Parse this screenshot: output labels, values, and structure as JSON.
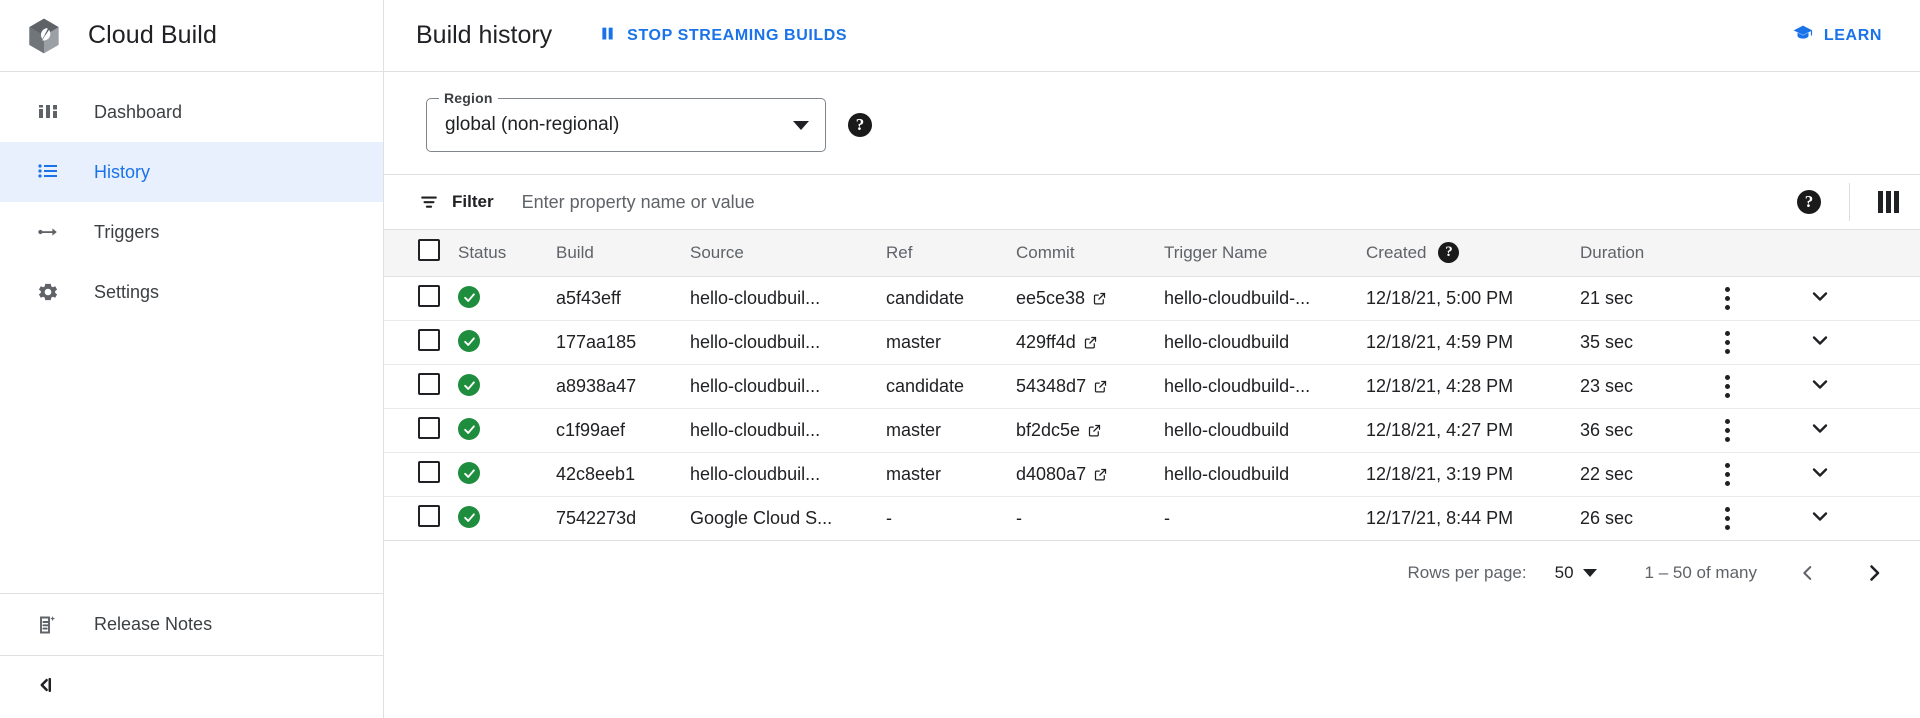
{
  "colors": {
    "accent": "#1a73e8",
    "success": "#1e8e3e",
    "nav_active_bg": "#e8f0fe",
    "header_bg": "#f5f5f5",
    "text_primary": "#202124",
    "text_secondary": "#5f6368"
  },
  "sidebar": {
    "product_title": "Cloud Build",
    "logo_icon": "cloud-build-logo-icon",
    "items": [
      {
        "label": "Dashboard",
        "icon": "dashboard-icon",
        "active": false
      },
      {
        "label": "History",
        "icon": "list-icon",
        "active": true
      },
      {
        "label": "Triggers",
        "icon": "arrow-switch-icon",
        "active": false
      },
      {
        "label": "Settings",
        "icon": "gear-icon",
        "active": false
      }
    ],
    "release_notes": {
      "label": "Release Notes",
      "icon": "release-notes-icon"
    },
    "collapse": {
      "icon": "collapse-panel-icon",
      "label": ""
    }
  },
  "topbar": {
    "page_title": "Build history",
    "stop_streaming_label": "STOP STREAMING BUILDS",
    "stop_streaming_icon": "pause-icon",
    "learn_label": "LEARN",
    "learn_icon": "graduation-cap-icon"
  },
  "region": {
    "legend": "Region",
    "value": "global (non-regional)",
    "dropdown_icon": "chevron-down-icon",
    "help_icon": "help-icon",
    "help_label": "?"
  },
  "filter": {
    "icon": "filter-icon",
    "label": "Filter",
    "placeholder": "Enter property name or value",
    "value": "",
    "help_label": "?",
    "help_icon": "help-icon",
    "columns_icon": "column-display-options-icon"
  },
  "table": {
    "columns": [
      {
        "key": "checkbox",
        "label": ""
      },
      {
        "key": "status",
        "label": "Status"
      },
      {
        "key": "build",
        "label": "Build"
      },
      {
        "key": "source",
        "label": "Source"
      },
      {
        "key": "ref",
        "label": "Ref"
      },
      {
        "key": "commit",
        "label": "Commit"
      },
      {
        "key": "trigger",
        "label": "Trigger Name"
      },
      {
        "key": "created",
        "label": "Created"
      },
      {
        "key": "duration",
        "label": "Duration"
      }
    ],
    "created_help_icon": "help-icon",
    "created_help_label": "?",
    "header_checkbox_checked": false,
    "rows": [
      {
        "status": "succeeded",
        "status_icon": "check-circle-icon",
        "build": "a5f43eff",
        "source": "hello-cloudbuil...",
        "ref": "candidate",
        "commit": "ee5ce38",
        "trigger": "hello-cloudbuild-...",
        "created": "12/18/21, 5:00 PM",
        "duration": "21 sec"
      },
      {
        "status": "succeeded",
        "status_icon": "check-circle-icon",
        "build": "177aa185",
        "source": "hello-cloudbuil...",
        "ref": "master",
        "commit": "429ff4d",
        "trigger": "hello-cloudbuild",
        "created": "12/18/21, 4:59 PM",
        "duration": "35 sec"
      },
      {
        "status": "succeeded",
        "status_icon": "check-circle-icon",
        "build": "a8938a47",
        "source": "hello-cloudbuil...",
        "ref": "candidate",
        "commit": "54348d7",
        "trigger": "hello-cloudbuild-...",
        "created": "12/18/21, 4:28 PM",
        "duration": "23 sec"
      },
      {
        "status": "succeeded",
        "status_icon": "check-circle-icon",
        "build": "c1f99aef",
        "source": "hello-cloudbuil...",
        "ref": "master",
        "commit": "bf2dc5e",
        "trigger": "hello-cloudbuild",
        "created": "12/18/21, 4:27 PM",
        "duration": "36 sec"
      },
      {
        "status": "succeeded",
        "status_icon": "check-circle-icon",
        "build": "42c8eeb1",
        "source": "hello-cloudbuil...",
        "ref": "master",
        "commit": "d4080a7",
        "trigger": "hello-cloudbuild",
        "created": "12/18/21, 3:19 PM",
        "duration": "22 sec"
      },
      {
        "status": "succeeded",
        "status_icon": "check-circle-icon",
        "build": "7542273d",
        "source": "Google Cloud S...",
        "ref": "-",
        "commit": "-",
        "trigger": "-",
        "created": "12/17/21, 8:44 PM",
        "duration": "26 sec"
      }
    ],
    "row_menu_icon": "more-vert-icon",
    "row_expand_icon": "chevron-down-icon",
    "commit_external_icon": "open-in-new-icon"
  },
  "paginator": {
    "rows_per_page_label": "Rows per page:",
    "rows_per_page_value": "50",
    "rows_per_page_icon": "chevron-down-icon",
    "range_label": "1 – 50 of many",
    "prev_icon": "chevron-left-icon",
    "next_icon": "chevron-right-icon"
  }
}
